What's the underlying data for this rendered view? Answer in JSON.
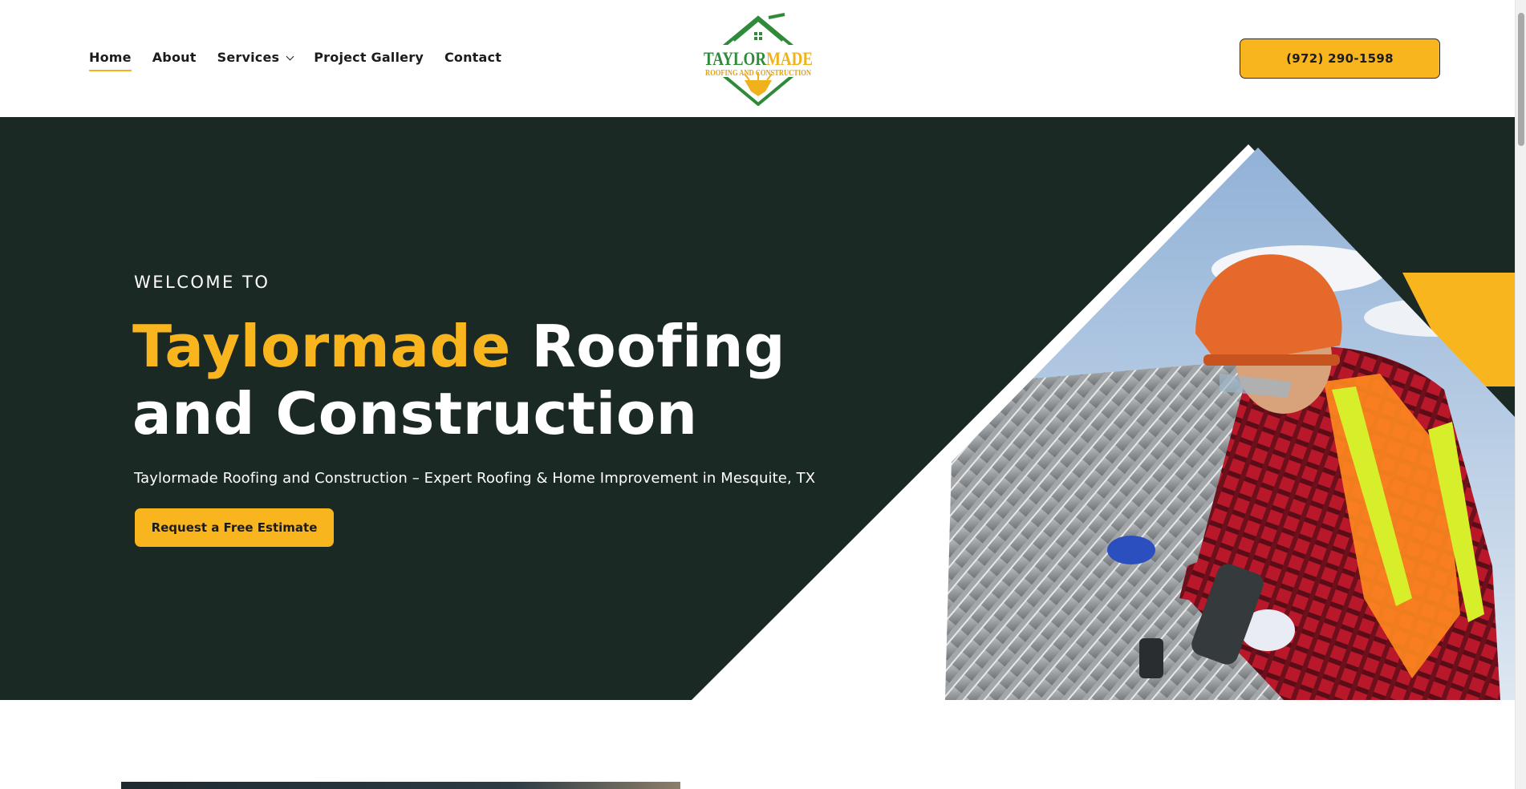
{
  "header": {
    "nav": [
      {
        "label": "Home",
        "active": true
      },
      {
        "label": "About"
      },
      {
        "label": "Services",
        "has_dropdown": true
      },
      {
        "label": "Project Gallery"
      },
      {
        "label": "Contact"
      }
    ],
    "logo": {
      "name": "TAYLORMADE",
      "name_part1": "TAYLOR",
      "name_part2": "MADE",
      "subtitle": "ROOFING AND CONSTRUCTION",
      "icon": "house-hammer-diamond-logo"
    },
    "phone_label": "(972) 290-1598"
  },
  "hero": {
    "eyebrow": "WELCOME TO",
    "headline_brand": "Taylormade",
    "headline_rest": " Roofing and Construction",
    "tagline": "Taylormade Roofing and Construction – Expert Roofing & Home Improvement in Mesquite, TX",
    "cta_label": "Request a Free Estimate",
    "image": "roofer-worker-photo"
  },
  "colors": {
    "accent": "#f9b51e",
    "hero_bg": "#1b2925",
    "logo_green": "#2f8a3a",
    "text_dark": "#1c1c1c"
  }
}
